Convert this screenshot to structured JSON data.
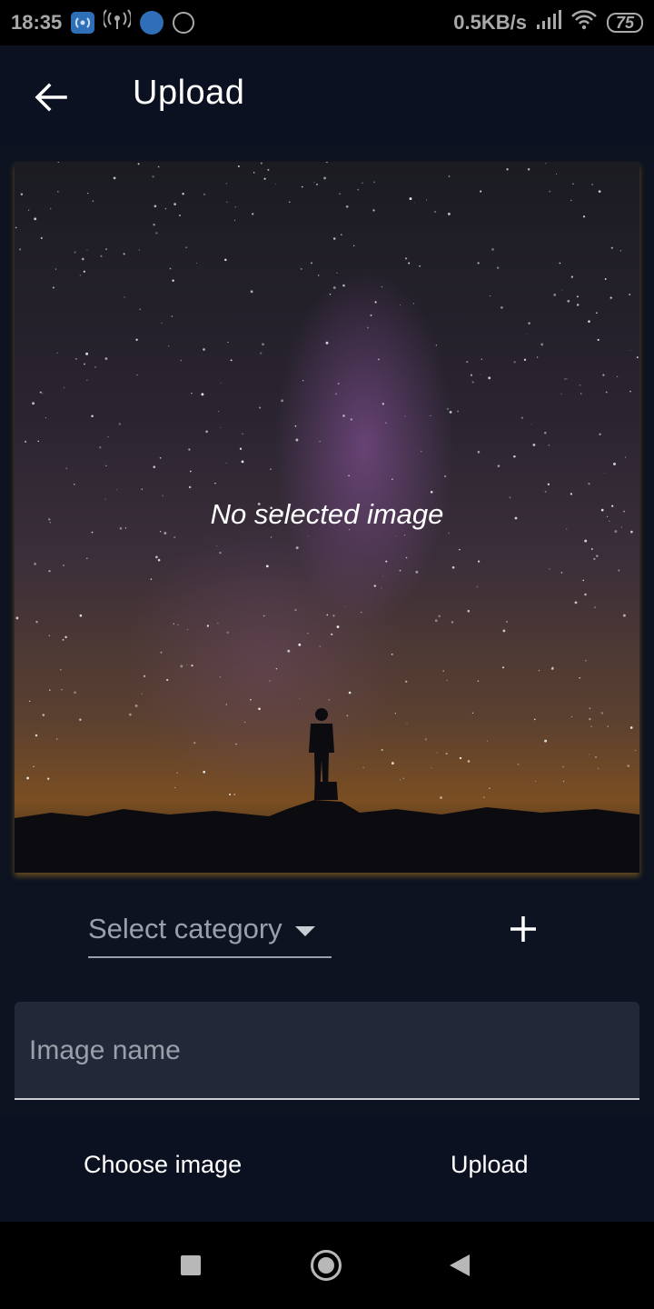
{
  "status_bar": {
    "time": "18:35",
    "network_speed": "0.5KB/s",
    "battery": "75",
    "icons": [
      "hotspot-icon",
      "radio-icon",
      "wifi-badge-icon",
      "circle-icon",
      "signal-icon",
      "wifi-icon",
      "battery-icon"
    ]
  },
  "app_bar": {
    "title": "Upload",
    "back_icon": "arrow-left-icon"
  },
  "preview": {
    "message": "No selected image"
  },
  "category": {
    "label": "Select category",
    "add_icon": "plus-icon"
  },
  "image_name": {
    "placeholder": "Image name",
    "value": ""
  },
  "actions": {
    "choose_label": "Choose image",
    "upload_label": "Upload"
  },
  "colors": {
    "background": "#0d1321",
    "app_bar": "#0b1120",
    "input_fill": "#222838",
    "accent_glow": "#aa781e"
  }
}
